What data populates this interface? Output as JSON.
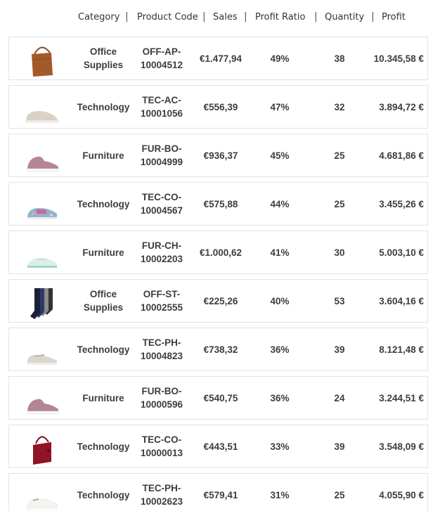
{
  "header": {
    "columns": [
      "Category",
      "Product Code",
      "Sales",
      "Profit Ratio",
      "Quantity",
      "Profit"
    ],
    "separator": "|"
  },
  "rows": [
    {
      "image": "brown-handbag",
      "category": "Office Supplies",
      "code": "OFF-AP-10004512",
      "sales": "€1.477,94",
      "ratio": "49%",
      "quantity": "38",
      "profit": "10.345,58 €"
    },
    {
      "image": "beige-sneaker",
      "category": "Technology",
      "code": "TEC-AC-10001056",
      "sales": "€556,39",
      "ratio": "47%",
      "quantity": "32",
      "profit": "3.894,72 €"
    },
    {
      "image": "pink-sneaker",
      "category": "Furniture",
      "code": "FUR-BO-10004999",
      "sales": "€936,37",
      "ratio": "45%",
      "quantity": "25",
      "profit": "4.681,86 €"
    },
    {
      "image": "colorful-kids-sneaker",
      "category": "Technology",
      "code": "TEC-CO-10004567",
      "sales": "€575,88",
      "ratio": "44%",
      "quantity": "25",
      "profit": "3.455,26 €"
    },
    {
      "image": "mint-canvas-sneaker",
      "category": "Furniture",
      "code": "FUR-CH-10002203",
      "sales": "€1.000,62",
      "ratio": "41%",
      "quantity": "30",
      "profit": "5.003,10 €"
    },
    {
      "image": "socks-pack",
      "category": "Office Supplies",
      "code": "OFF-ST-10002555",
      "sales": "€225,26",
      "ratio": "40%",
      "quantity": "53",
      "profit": "3.604,16 €"
    },
    {
      "image": "silver-mary-jane-shoe",
      "category": "Technology",
      "code": "TEC-PH-10004823",
      "sales": "€738,32",
      "ratio": "36%",
      "quantity": "39",
      "profit": "8.121,48 €"
    },
    {
      "image": "pink-sneaker",
      "category": "Furniture",
      "code": "FUR-BO-10000596",
      "sales": "€540,75",
      "ratio": "36%",
      "quantity": "24",
      "profit": "3.244,51 €"
    },
    {
      "image": "red-handbag",
      "category": "Technology",
      "code": "TEC-CO-10000013",
      "sales": "€443,51",
      "ratio": "33%",
      "quantity": "39",
      "profit": "3.548,09 €"
    },
    {
      "image": "white-sneaker",
      "category": "Technology",
      "code": "TEC-PH-10002623",
      "sales": "€579,41",
      "ratio": "31%",
      "quantity": "25",
      "profit": "4.055,90 €"
    }
  ]
}
